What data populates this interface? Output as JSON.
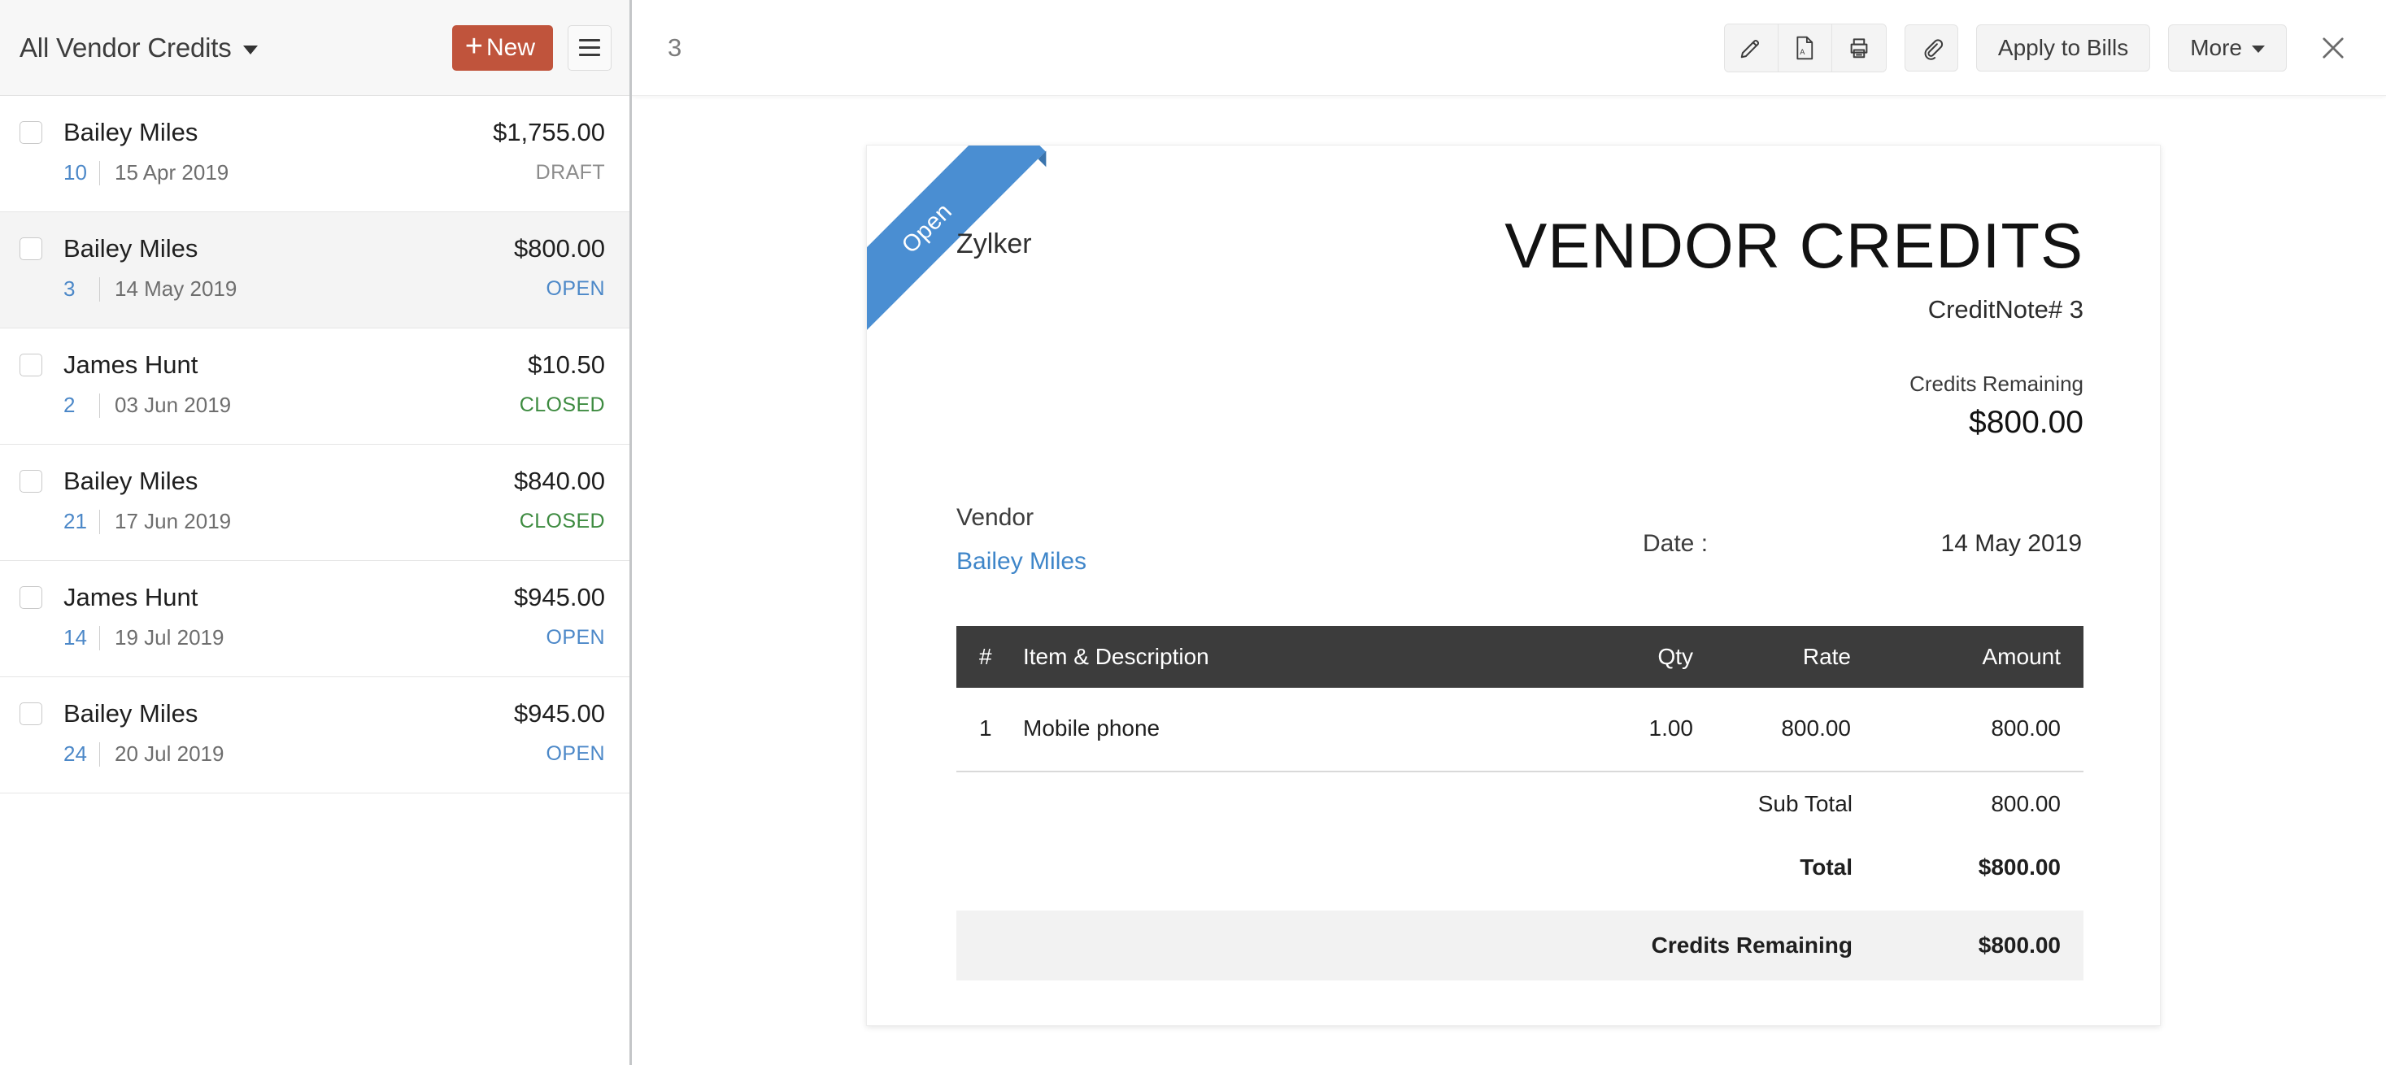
{
  "sidebar": {
    "view_title": "All Vendor Credits",
    "new_button_label": "New",
    "menu_icon": "hamburger-icon",
    "rows": [
      {
        "vendor": "Bailey Miles",
        "amount": "$1,755.00",
        "number": "10",
        "date": "15 Apr 2019",
        "status": "DRAFT",
        "status_kind": "draft",
        "selected": false
      },
      {
        "vendor": "Bailey Miles",
        "amount": "$800.00",
        "number": "3",
        "date": "14 May 2019",
        "status": "OPEN",
        "status_kind": "open",
        "selected": true
      },
      {
        "vendor": "James Hunt",
        "amount": "$10.50",
        "number": "2",
        "date": "03 Jun 2019",
        "status": "CLOSED",
        "status_kind": "closed",
        "selected": false
      },
      {
        "vendor": "Bailey Miles",
        "amount": "$840.00",
        "number": "21",
        "date": "17 Jun 2019",
        "status": "CLOSED",
        "status_kind": "closed",
        "selected": false
      },
      {
        "vendor": "James Hunt",
        "amount": "$945.00",
        "number": "14",
        "date": "19 Jul 2019",
        "status": "OPEN",
        "status_kind": "open",
        "selected": false
      },
      {
        "vendor": "Bailey Miles",
        "amount": "$945.00",
        "number": "24",
        "date": "20 Jul 2019",
        "status": "OPEN",
        "status_kind": "open",
        "selected": false
      }
    ]
  },
  "detail_header": {
    "doc_number": "3",
    "icons": [
      "edit-pencil-icon",
      "pdf-file-icon",
      "print-icon",
      "attachment-paperclip-icon"
    ],
    "apply_to_bills_label": "Apply to Bills",
    "more_label": "More",
    "close_icon": "close-icon"
  },
  "document": {
    "ribbon_status": "Open",
    "organization": "Zylker",
    "title": "VENDOR CREDITS",
    "reference": "CreditNote# 3",
    "credits_remaining_label": "Credits Remaining",
    "credits_remaining_value": "$800.00",
    "vendor_label": "Vendor",
    "vendor_name": "Bailey Miles",
    "date_label": "Date :",
    "date_value": "14 May 2019",
    "table": {
      "columns": [
        "#",
        "Item & Description",
        "Qty",
        "Rate",
        "Amount"
      ],
      "rows": [
        {
          "idx": "1",
          "item": "Mobile phone",
          "qty": "1.00",
          "rate": "800.00",
          "amount": "800.00"
        }
      ]
    },
    "totals": [
      {
        "label": "Sub Total",
        "value": "800.00",
        "style": "plain"
      },
      {
        "label": "Total",
        "value": "$800.00",
        "style": "grand"
      },
      {
        "label": "Credits Remaining",
        "value": "$800.00",
        "style": "highlight"
      }
    ]
  },
  "colors": {
    "accent_red": "#c0543c",
    "ribbon_blue": "#4a8ed2",
    "link_blue": "#4c88c8",
    "status_closed_green": "#3d8b40",
    "table_header_dark": "#3c3c3c"
  }
}
